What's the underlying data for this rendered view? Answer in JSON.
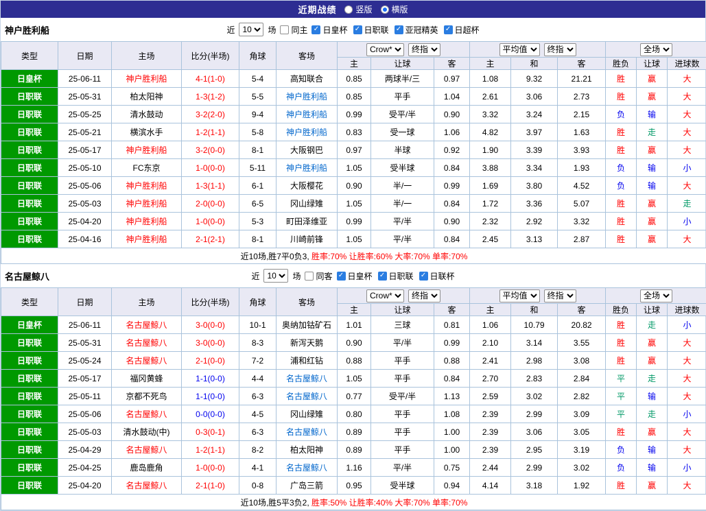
{
  "topbar": {
    "title": "近期战绩",
    "radio_vertical": "竖版",
    "radio_horizontal": "横版",
    "selected_layout": "横版"
  },
  "controls": {
    "bookmaker": "Crow*",
    "final_odds": "终指",
    "average": "平均值",
    "full_match": "全场"
  },
  "col_headers": {
    "main": [
      "类型",
      "日期",
      "主场",
      "比分(半场)",
      "角球",
      "客场"
    ],
    "sub": [
      "主",
      "让球",
      "客",
      "主",
      "和",
      "客",
      "胜负",
      "让球",
      "进球数"
    ]
  },
  "colors": {
    "topbar_bg": "#2d2d92",
    "badge_green": "#009900",
    "win_red": "#ff0000",
    "lose_blue": "#0000ee",
    "push_green": "#009966",
    "away_team_blue": "#0066cc",
    "home_team_red": "#ff0000",
    "header_bg": "#e9e9f4",
    "border": "#a9c3dc"
  },
  "sections": [
    {
      "team": "神户胜利船",
      "filter": {
        "near_label": "近",
        "games_value": "10",
        "games_label": "场",
        "same_label": "同主",
        "same_checked": false,
        "leagues": [
          {
            "label": "日皇杯",
            "checked": true
          },
          {
            "label": "日职联",
            "checked": true
          },
          {
            "label": "亚冠精英",
            "checked": true
          },
          {
            "label": "日超杯",
            "checked": true
          }
        ]
      },
      "rows": [
        {
          "cells": [
            "日皇杯",
            "25-06-11",
            "神户胜利船",
            "4-1(1-0)",
            "5-4",
            "高知联合",
            "0.85",
            "两球半/三",
            "0.97",
            "1.08",
            "9.32",
            "21.21",
            "胜",
            "赢",
            "大"
          ],
          "colors": [
            "k",
            "k",
            "r",
            "r",
            "k",
            "k",
            "k",
            "k",
            "k",
            "k",
            "k",
            "k",
            "r",
            "r",
            "r"
          ]
        },
        {
          "cells": [
            "日职联",
            "25-05-31",
            "柏太阳神",
            "1-3(1-2)",
            "5-5",
            "神户胜利船",
            "0.85",
            "平手",
            "1.04",
            "2.61",
            "3.06",
            "2.73",
            "胜",
            "赢",
            "大"
          ],
          "colors": [
            "k",
            "k",
            "k",
            "r",
            "k",
            "a",
            "k",
            "k",
            "k",
            "k",
            "k",
            "k",
            "r",
            "r",
            "r"
          ]
        },
        {
          "cells": [
            "日职联",
            "25-05-25",
            "清水鼓动",
            "3-2(2-0)",
            "9-4",
            "神户胜利船",
            "0.99",
            "受平/半",
            "0.90",
            "3.32",
            "3.24",
            "2.15",
            "负",
            "输",
            "大"
          ],
          "colors": [
            "k",
            "k",
            "k",
            "r",
            "k",
            "a",
            "k",
            "k",
            "k",
            "k",
            "k",
            "k",
            "b",
            "b",
            "r"
          ]
        },
        {
          "cells": [
            "日职联",
            "25-05-21",
            "横滨水手",
            "1-2(1-1)",
            "5-8",
            "神户胜利船",
            "0.83",
            "受一球",
            "1.06",
            "4.82",
            "3.97",
            "1.63",
            "胜",
            "走",
            "大"
          ],
          "colors": [
            "k",
            "k",
            "k",
            "r",
            "k",
            "a",
            "k",
            "k",
            "k",
            "k",
            "k",
            "k",
            "r",
            "g",
            "r"
          ]
        },
        {
          "cells": [
            "日职联",
            "25-05-17",
            "神户胜利船",
            "3-2(0-0)",
            "8-1",
            "大阪钢巴",
            "0.97",
            "半球",
            "0.92",
            "1.90",
            "3.39",
            "3.93",
            "胜",
            "赢",
            "大"
          ],
          "colors": [
            "k",
            "k",
            "r",
            "r",
            "k",
            "k",
            "k",
            "k",
            "k",
            "k",
            "k",
            "k",
            "r",
            "r",
            "r"
          ]
        },
        {
          "cells": [
            "日职联",
            "25-05-10",
            "FC东京",
            "1-0(0-0)",
            "5-11",
            "神户胜利船",
            "1.05",
            "受半球",
            "0.84",
            "3.88",
            "3.34",
            "1.93",
            "负",
            "输",
            "小"
          ],
          "colors": [
            "k",
            "k",
            "k",
            "r",
            "k",
            "a",
            "k",
            "k",
            "k",
            "k",
            "k",
            "k",
            "b",
            "b",
            "b"
          ]
        },
        {
          "cells": [
            "日职联",
            "25-05-06",
            "神户胜利船",
            "1-3(1-1)",
            "6-1",
            "大阪樱花",
            "0.90",
            "半/一",
            "0.99",
            "1.69",
            "3.80",
            "4.52",
            "负",
            "输",
            "大"
          ],
          "colors": [
            "k",
            "k",
            "r",
            "r",
            "k",
            "k",
            "k",
            "k",
            "k",
            "k",
            "k",
            "k",
            "b",
            "b",
            "r"
          ]
        },
        {
          "cells": [
            "日职联",
            "25-05-03",
            "神户胜利船",
            "2-0(0-0)",
            "6-5",
            "冈山绿雉",
            "1.05",
            "半/一",
            "0.84",
            "1.72",
            "3.36",
            "5.07",
            "胜",
            "赢",
            "走"
          ],
          "colors": [
            "k",
            "k",
            "r",
            "r",
            "k",
            "k",
            "k",
            "k",
            "k",
            "k",
            "k",
            "k",
            "r",
            "r",
            "g"
          ]
        },
        {
          "cells": [
            "日职联",
            "25-04-20",
            "神户胜利船",
            "1-0(0-0)",
            "5-3",
            "町田泽维亚",
            "0.99",
            "平/半",
            "0.90",
            "2.32",
            "2.92",
            "3.32",
            "胜",
            "赢",
            "小"
          ],
          "colors": [
            "k",
            "k",
            "r",
            "r",
            "k",
            "k",
            "k",
            "k",
            "k",
            "k",
            "k",
            "k",
            "r",
            "r",
            "b"
          ]
        },
        {
          "cells": [
            "日职联",
            "25-04-16",
            "神户胜利船",
            "2-1(2-1)",
            "8-1",
            "川崎前锋",
            "1.05",
            "平/半",
            "0.84",
            "2.45",
            "3.13",
            "2.87",
            "胜",
            "赢",
            "大"
          ],
          "colors": [
            "k",
            "k",
            "r",
            "r",
            "k",
            "k",
            "k",
            "k",
            "k",
            "k",
            "k",
            "k",
            "r",
            "r",
            "r"
          ]
        }
      ],
      "summary_prefix": "近10场,胜7平0负3, ",
      "summary_stats": "胜率:70% 让胜率:60% 大率:70% 单率:70%"
    },
    {
      "team": "名古屋鲸八",
      "filter": {
        "near_label": "近",
        "games_value": "10",
        "games_label": "场",
        "same_label": "同客",
        "same_checked": false,
        "leagues": [
          {
            "label": "日皇杯",
            "checked": true
          },
          {
            "label": "日职联",
            "checked": true
          },
          {
            "label": "日联杯",
            "checked": true
          }
        ]
      },
      "rows": [
        {
          "cells": [
            "日皇杯",
            "25-06-11",
            "名古屋鲸八",
            "3-0(0-0)",
            "10-1",
            "奥纳加钴矿石",
            "1.01",
            "三球",
            "0.81",
            "1.06",
            "10.79",
            "20.82",
            "胜",
            "走",
            "小"
          ],
          "colors": [
            "k",
            "k",
            "r",
            "r",
            "k",
            "k",
            "k",
            "k",
            "k",
            "k",
            "k",
            "k",
            "r",
            "g",
            "b"
          ]
        },
        {
          "cells": [
            "日职联",
            "25-05-31",
            "名古屋鲸八",
            "3-0(0-0)",
            "8-3",
            "新泻天鹅",
            "0.90",
            "平/半",
            "0.99",
            "2.10",
            "3.14",
            "3.55",
            "胜",
            "赢",
            "大"
          ],
          "colors": [
            "k",
            "k",
            "r",
            "r",
            "k",
            "k",
            "k",
            "k",
            "k",
            "k",
            "k",
            "k",
            "r",
            "r",
            "r"
          ]
        },
        {
          "cells": [
            "日职联",
            "25-05-24",
            "名古屋鲸八",
            "2-1(0-0)",
            "7-2",
            "浦和红钻",
            "0.88",
            "平手",
            "0.88",
            "2.41",
            "2.98",
            "3.08",
            "胜",
            "赢",
            "大"
          ],
          "colors": [
            "k",
            "k",
            "r",
            "r",
            "k",
            "k",
            "k",
            "k",
            "k",
            "k",
            "k",
            "k",
            "r",
            "r",
            "r"
          ]
        },
        {
          "cells": [
            "日职联",
            "25-05-17",
            "福冈黄蜂",
            "1-1(0-0)",
            "4-4",
            "名古屋鲸八",
            "1.05",
            "平手",
            "0.84",
            "2.70",
            "2.83",
            "2.84",
            "平",
            "走",
            "大"
          ],
          "colors": [
            "k",
            "k",
            "k",
            "b",
            "k",
            "a",
            "k",
            "k",
            "k",
            "k",
            "k",
            "k",
            "g",
            "g",
            "r"
          ]
        },
        {
          "cells": [
            "日职联",
            "25-05-11",
            "京都不死鸟",
            "1-1(0-0)",
            "6-3",
            "名古屋鲸八",
            "0.77",
            "受平/半",
            "1.13",
            "2.59",
            "3.02",
            "2.82",
            "平",
            "输",
            "大"
          ],
          "colors": [
            "k",
            "k",
            "k",
            "b",
            "k",
            "a",
            "k",
            "k",
            "k",
            "k",
            "k",
            "k",
            "g",
            "b",
            "r"
          ]
        },
        {
          "cells": [
            "日职联",
            "25-05-06",
            "名古屋鲸八",
            "0-0(0-0)",
            "4-5",
            "冈山绿雉",
            "0.80",
            "平手",
            "1.08",
            "2.39",
            "2.99",
            "3.09",
            "平",
            "走",
            "小"
          ],
          "colors": [
            "k",
            "k",
            "r",
            "b",
            "k",
            "k",
            "k",
            "k",
            "k",
            "k",
            "k",
            "k",
            "g",
            "g",
            "b"
          ]
        },
        {
          "cells": [
            "日职联",
            "25-05-03",
            "清水鼓动(中)",
            "0-3(0-1)",
            "6-3",
            "名古屋鲸八",
            "0.89",
            "平手",
            "1.00",
            "2.39",
            "3.06",
            "3.05",
            "胜",
            "赢",
            "大"
          ],
          "colors": [
            "k",
            "k",
            "k",
            "r",
            "k",
            "a",
            "k",
            "k",
            "k",
            "k",
            "k",
            "k",
            "r",
            "r",
            "r"
          ]
        },
        {
          "cells": [
            "日职联",
            "25-04-29",
            "名古屋鲸八",
            "1-2(1-1)",
            "8-2",
            "柏太阳神",
            "0.89",
            "平手",
            "1.00",
            "2.39",
            "2.95",
            "3.19",
            "负",
            "输",
            "大"
          ],
          "colors": [
            "k",
            "k",
            "r",
            "r",
            "k",
            "k",
            "k",
            "k",
            "k",
            "k",
            "k",
            "k",
            "b",
            "b",
            "r"
          ]
        },
        {
          "cells": [
            "日职联",
            "25-04-25",
            "鹿岛鹿角",
            "1-0(0-0)",
            "4-1",
            "名古屋鲸八",
            "1.16",
            "平/半",
            "0.75",
            "2.44",
            "2.99",
            "3.02",
            "负",
            "输",
            "小"
          ],
          "colors": [
            "k",
            "k",
            "k",
            "r",
            "k",
            "a",
            "k",
            "k",
            "k",
            "k",
            "k",
            "k",
            "b",
            "b",
            "b"
          ]
        },
        {
          "cells": [
            "日职联",
            "25-04-20",
            "名古屋鲸八",
            "2-1(1-0)",
            "0-8",
            "广岛三箭",
            "0.95",
            "受半球",
            "0.94",
            "4.14",
            "3.18",
            "1.92",
            "胜",
            "赢",
            "大"
          ],
          "colors": [
            "k",
            "k",
            "r",
            "r",
            "k",
            "k",
            "k",
            "k",
            "k",
            "k",
            "k",
            "k",
            "r",
            "r",
            "r"
          ]
        }
      ],
      "summary_prefix": "近10场,胜5平3负2, ",
      "summary_stats": "胜率:50% 让胜率:40% 大率:70% 单率:70%"
    }
  ]
}
